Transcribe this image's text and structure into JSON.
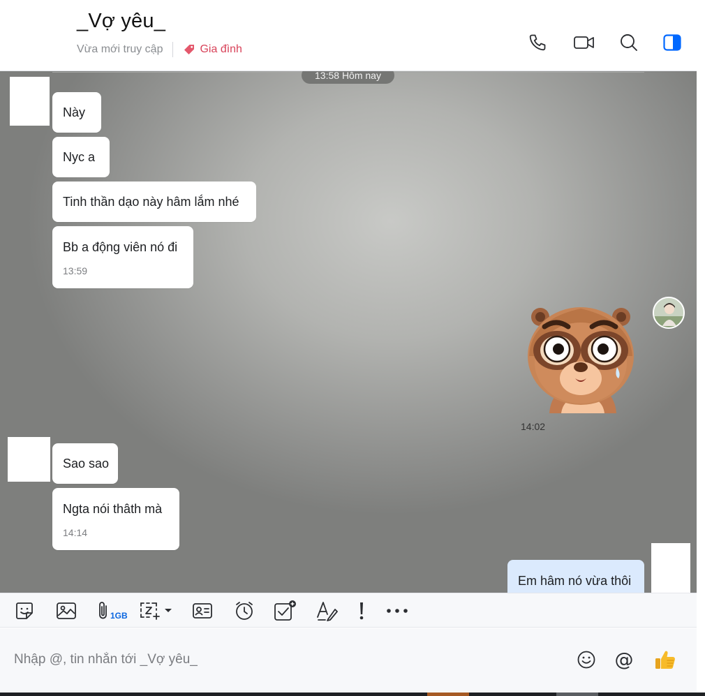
{
  "header": {
    "title": "_Vợ yêu_",
    "status": "Vừa mới truy cập",
    "tag": "Gia đình",
    "tag_color": "#d8435a",
    "icons": [
      "phone-icon",
      "video-call-icon",
      "search-icon",
      "sidebar-toggle-icon"
    ]
  },
  "chat": {
    "date_divider": "13:58 Hôm nay",
    "messages": [
      {
        "text": "Này"
      },
      {
        "text": "Nyc a"
      },
      {
        "text": "Tinh thần dạo này hâm lắm nhé"
      },
      {
        "text": "Bb a động viên nó đi",
        "time": "13:59"
      },
      {
        "sticker": "raccoon-sticker",
        "time": "14:02"
      },
      {
        "text": "Sao sao"
      },
      {
        "text": "Ngta nói thâth mà",
        "time": "14:14"
      },
      {
        "text": "Em hâm nó vừa thôi"
      }
    ]
  },
  "toolbar": {
    "attach_badge": "1GB",
    "icons": [
      "sticker-icon",
      "image-icon",
      "attach-file-icon",
      "screenshot-icon",
      "contact-card-icon",
      "reminder-icon",
      "todo-icon",
      "format-text-icon",
      "urgent-icon",
      "more-icon"
    ]
  },
  "composer": {
    "placeholder": "Nhập @, tin nhắn tới _Vợ yêu_",
    "mention_symbol": "@",
    "icons": [
      "emoji-icon",
      "mention-icon",
      "thumbs-up-icon"
    ]
  },
  "colors": {
    "incoming_bubble": "#ffffff",
    "outgoing_bubble": "#dbeafd",
    "accent": "#0068ff"
  }
}
